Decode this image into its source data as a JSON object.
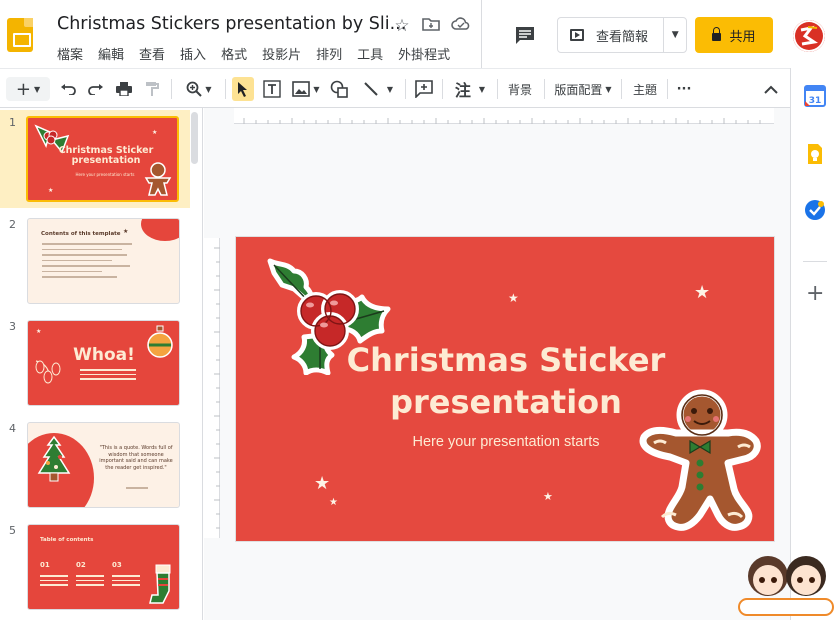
{
  "header": {
    "doc_title": "Christmas Stickers presentation by Sli...",
    "menu": [
      "檔案",
      "編輯",
      "查看",
      "插入",
      "格式",
      "投影片",
      "排列",
      "工具",
      "外掛程式"
    ],
    "present_label": "查看簡報",
    "share_label": "共用",
    "icons": [
      "star-icon",
      "move-folder-icon",
      "cloud-status-icon",
      "comment-icon"
    ]
  },
  "toolbar": {
    "notes_label": "注",
    "background_label": "背景",
    "layout_label": "版面配置",
    "theme_label": "主題",
    "more_label": "···"
  },
  "filmstrip": {
    "slides": [
      {
        "number": "1",
        "title": "Christmas Sticker presentation",
        "subtitle": "Here your presentation starts"
      },
      {
        "number": "2",
        "title": "Contents of this template"
      },
      {
        "number": "3",
        "title": "Whoa!"
      },
      {
        "number": "4",
        "quote": "\"This is a quote. Words full of wisdom that someone important said and can make the reader get inspired.\""
      },
      {
        "number": "5",
        "title": "Table of contents",
        "items": [
          "01",
          "02",
          "03"
        ]
      }
    ]
  },
  "slide": {
    "title_line1": "Christmas Sticker",
    "title_line2": "presentation",
    "subtitle": "Here your presentation starts"
  },
  "colors": {
    "slide_red": "#e5493f",
    "cream_text": "#fdebd3",
    "share_yellow": "#fbbc04",
    "selected_bg": "#feefc3"
  }
}
